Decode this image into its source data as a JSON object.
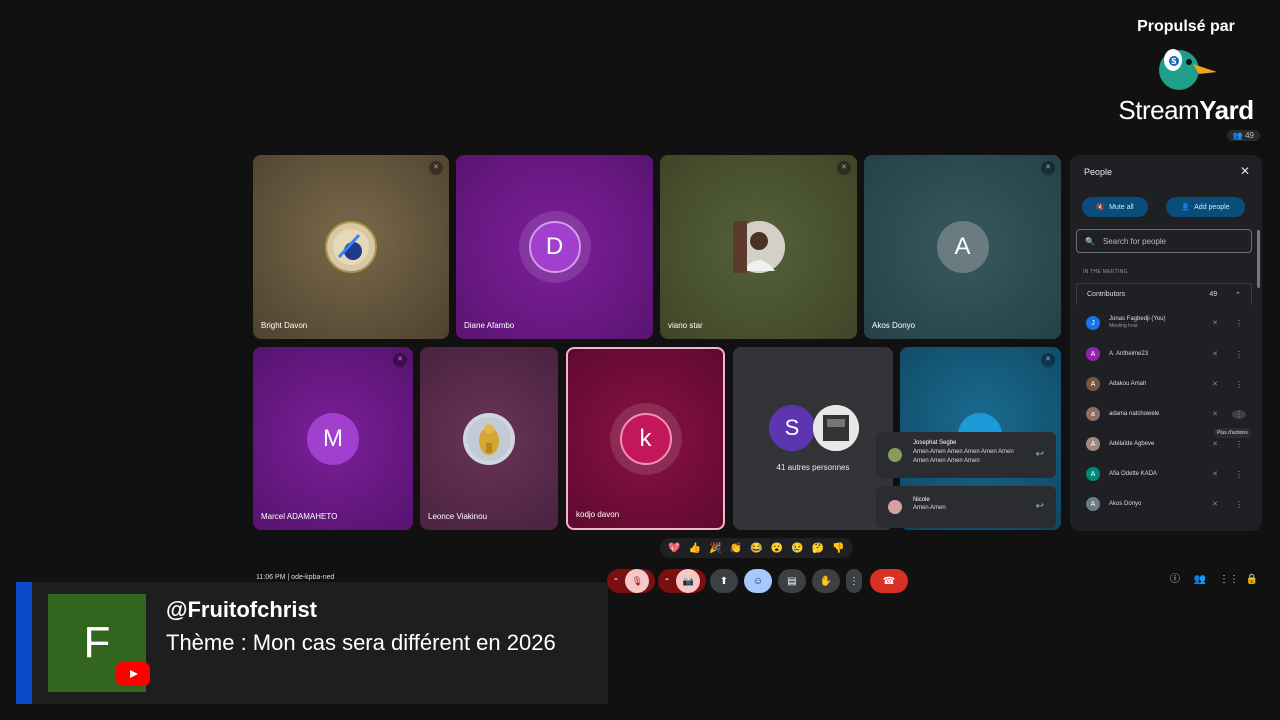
{
  "branding": {
    "powered_by": "Propulsé par",
    "name_light": "Stream",
    "name_bold": "Yard",
    "viewer_count": "49"
  },
  "tiles_row1": [
    {
      "name": "Bright Davon",
      "kind": "image",
      "bg": "#6a5a40"
    },
    {
      "name": "Diane Afambo",
      "kind": "letter",
      "letter": "D",
      "bg": "#6e1a8a",
      "avatar_color": "#a13fcf"
    },
    {
      "name": "viano star",
      "kind": "photo",
      "bg": "#4a5230"
    },
    {
      "name": "Akos Donyo",
      "kind": "letter",
      "letter": "A",
      "bg": "#2f5058",
      "avatar_color": "#6a7b82"
    }
  ],
  "tiles_row2": [
    {
      "name": "Marcel ADAMAHETO",
      "kind": "letter",
      "letter": "M",
      "bg": "#6a1a85",
      "avatar_color": "#a13fcf"
    },
    {
      "name": "Leonce Viakinou",
      "kind": "image",
      "bg": "#5a2c4a"
    },
    {
      "name": "kodjo davon",
      "kind": "letter",
      "letter": "k",
      "bg": "#7a0f3c",
      "avatar_color": "#c2185b"
    },
    {
      "name": "41 autres personnes",
      "kind": "group",
      "letter": "S",
      "bg": "#333438"
    },
    {
      "name": "",
      "kind": "partial",
      "bg": "#135a7a"
    }
  ],
  "people_panel": {
    "title": "People",
    "mute_all": "Mute all",
    "add_people": "Add people",
    "search_placeholder": "Search for people",
    "section": "IN THE MEETING",
    "group_label": "Contributors",
    "group_count": "49",
    "tooltip": "Plus d'actions",
    "people": [
      {
        "name": "Jonas Fagbedji (You)",
        "sub": "Meeting host",
        "letter": "J",
        "color": "#1a73e8"
      },
      {
        "name": "A. Antheime23",
        "sub": "",
        "letter": "A",
        "color": "#8e24aa"
      },
      {
        "name": "Adakou Amah",
        "sub": "",
        "letter": "A",
        "color": "#795548"
      },
      {
        "name": "adama natchowele",
        "sub": "",
        "letter": "a",
        "color": "#8d6e63"
      },
      {
        "name": "Adélaïde Agbeve",
        "sub": "",
        "letter": "A",
        "color": "#a1887f"
      },
      {
        "name": "Afia Odette KADA",
        "sub": "",
        "letter": "A",
        "color": "#00897b"
      },
      {
        "name": "Akos Donyo",
        "sub": "",
        "letter": "A",
        "color": "#6a7b82"
      }
    ]
  },
  "chat": [
    {
      "name": "Josephat Segbe",
      "text": "Amen Amen Amen Amen Amen Amen Amen Amen Amen Amen"
    },
    {
      "name": "Nicole",
      "text": "Amen Amen"
    }
  ],
  "reactions": [
    "💖",
    "👍",
    "🎉",
    "👏",
    "😂",
    "😮",
    "😢",
    "🤔",
    "👎"
  ],
  "meeting": {
    "time": "11:06 PM",
    "code": "ode-kpba-ned"
  },
  "lower_third": {
    "avatar_letter": "F",
    "handle": "@Fruitofchrist",
    "theme": "Thème : Mon cas sera différent en 2026"
  },
  "colors": {
    "accent_blue": "#0a48c7",
    "avatar_green": "#32661f",
    "end_call_red": "#d93025"
  }
}
